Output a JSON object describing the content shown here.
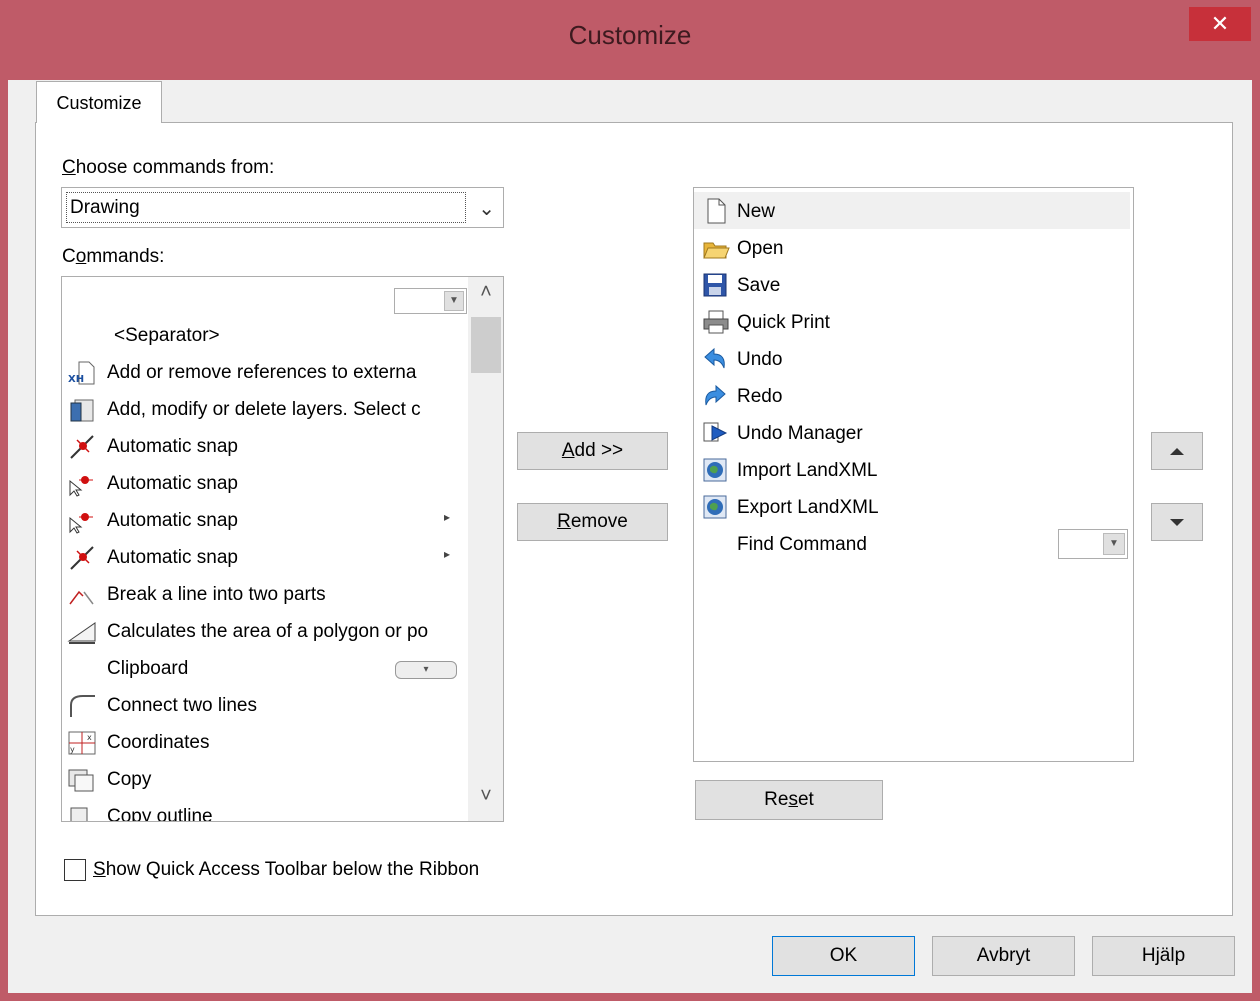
{
  "window": {
    "title": "Customize",
    "close_label": "✕"
  },
  "tab": {
    "label": "Customize"
  },
  "choose": {
    "label_prefix": "C",
    "label_rest": "hoose commands from:",
    "selected": "Drawing"
  },
  "commands": {
    "label_prefix": "C",
    "label_mid": "o",
    "label_rest": "mmands:",
    "items": [
      {
        "label": "",
        "icon": "empty"
      },
      {
        "label": "<Separator>",
        "icon": "none"
      },
      {
        "label": "Add or remove references to externa",
        "icon": "xref-icon"
      },
      {
        "label": "Add, modify or delete layers. Select c",
        "icon": "layers-icon"
      },
      {
        "label": "Automatic snap",
        "icon": "snap-icon"
      },
      {
        "label": "Automatic snap",
        "icon": "snap-cursor-icon"
      },
      {
        "label": "Automatic snap",
        "icon": "snap-cursor-icon",
        "submenu": "▸"
      },
      {
        "label": "Automatic snap",
        "icon": "snap-icon",
        "submenu": "▸"
      },
      {
        "label": "Break a line into two parts",
        "icon": "break-line-icon"
      },
      {
        "label": "Calculates the area of a polygon or po",
        "icon": "area-icon"
      },
      {
        "label": "Clipboard",
        "icon": "none",
        "dropdown": "▾"
      },
      {
        "label": "Connect two lines",
        "icon": "connect-lines-icon"
      },
      {
        "label": "Coordinates",
        "icon": "coordinates-icon"
      },
      {
        "label": "Copy",
        "icon": "copy-icon"
      },
      {
        "label": "Copy outline",
        "icon": "copy-outline-icon"
      }
    ]
  },
  "buttons": {
    "add_prefix": "A",
    "add_rest": "dd >>",
    "remove_prefix": "R",
    "remove_rest": "emove",
    "reset_prefix": "Re",
    "reset_u": "s",
    "reset_rest": "et",
    "ok": "OK",
    "cancel": "Avbryt",
    "help": "Hjälp"
  },
  "qat": {
    "items": [
      {
        "label": "New",
        "icon": "new-document-icon",
        "selected": true
      },
      {
        "label": "Open",
        "icon": "open-folder-icon"
      },
      {
        "label": "Save",
        "icon": "save-icon"
      },
      {
        "label": "Quick Print",
        "icon": "printer-icon"
      },
      {
        "label": "Undo",
        "icon": "undo-icon"
      },
      {
        "label": "Redo",
        "icon": "redo-icon"
      },
      {
        "label": "Undo Manager",
        "icon": "undo-manager-icon"
      },
      {
        "label": "Import LandXML",
        "icon": "import-landxml-icon"
      },
      {
        "label": "Export LandXML",
        "icon": "export-landxml-icon"
      },
      {
        "label": "Find Command",
        "icon": "none"
      }
    ]
  },
  "checkbox": {
    "checked": false,
    "label_prefix": "S",
    "label_rest": "how Quick Access Toolbar below the Ribbon"
  },
  "colors": {
    "title_bar": "#bf5b68",
    "close": "#c7303a",
    "selection": "#f0f0f0"
  }
}
